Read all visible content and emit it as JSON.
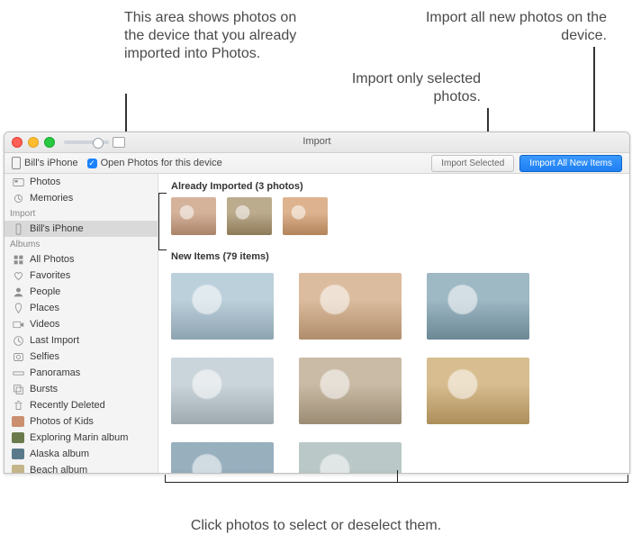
{
  "callouts": {
    "already_imported": "This area shows photos on the device that you already imported into Photos.",
    "import_all": "Import all new photos on the device.",
    "import_selected": "Import only selected photos.",
    "click_select": "Click photos to select or deselect them."
  },
  "window": {
    "title": "Import"
  },
  "toolbar": {
    "device_name": "Bill's iPhone",
    "open_photos_label": "Open Photos for this device",
    "import_selected_btn": "Import Selected",
    "import_all_btn": "Import All New Items"
  },
  "sidebar": {
    "groups": [
      {
        "header": null,
        "items": [
          {
            "icon": "photos",
            "label": "Photos"
          },
          {
            "icon": "memories",
            "label": "Memories"
          }
        ]
      },
      {
        "header": "Import",
        "items": [
          {
            "icon": "iphone",
            "label": "Bill's iPhone",
            "selected": true
          }
        ]
      },
      {
        "header": "Albums",
        "items": [
          {
            "icon": "all",
            "label": "All Photos"
          },
          {
            "icon": "heart",
            "label": "Favorites"
          },
          {
            "icon": "people",
            "label": "People"
          },
          {
            "icon": "pin",
            "label": "Places"
          },
          {
            "icon": "video",
            "label": "Videos"
          },
          {
            "icon": "clock",
            "label": "Last Import"
          },
          {
            "icon": "selfies",
            "label": "Selfies"
          },
          {
            "icon": "pano",
            "label": "Panoramas"
          },
          {
            "icon": "bursts",
            "label": "Bursts"
          },
          {
            "icon": "trash",
            "label": "Recently Deleted"
          },
          {
            "icon": "thumb",
            "label": "Photos of Kids",
            "thumb_color": "#c98f6f"
          },
          {
            "icon": "thumb",
            "label": "Exploring Marin album",
            "thumb_color": "#6b7a4a"
          },
          {
            "icon": "thumb",
            "label": "Alaska album",
            "thumb_color": "#5a7a8c"
          },
          {
            "icon": "thumb",
            "label": "Beach album",
            "thumb_color": "#c4b58a"
          }
        ]
      }
    ]
  },
  "main": {
    "already_header": "Already Imported (3 photos)",
    "already_thumbs": [
      "#c79a7a",
      "#a69068",
      "#d29a6a"
    ],
    "new_header": "New Items (79 items)",
    "new_thumbs": [
      "#a6c0cf",
      "#cfa67e",
      "#7ea0b0",
      "#b9c7cf",
      "#b7a488",
      "#caa76a",
      "#7595a9",
      "#a3b7b5"
    ]
  }
}
